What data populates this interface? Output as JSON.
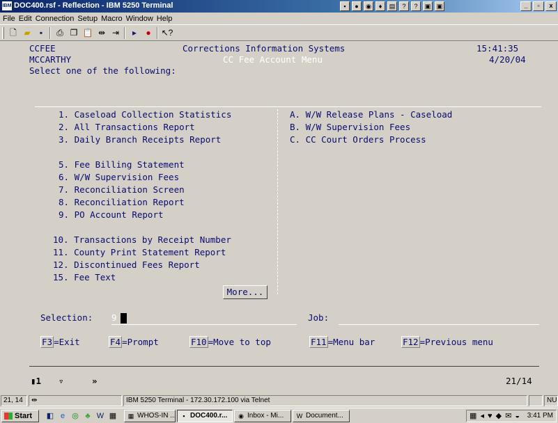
{
  "window": {
    "title": "DOC400.rsf - Reflection - IBM 5250 Terminal",
    "app_icon_text": "IBM",
    "caption_buttons": [
      "_",
      "▫",
      "x"
    ]
  },
  "menubar": [
    "File",
    "Edit",
    "Connection",
    "Setup",
    "Macro",
    "Window",
    "Help"
  ],
  "toolbar_icons": [
    "new-document-icon",
    "open-folder-icon",
    "save-icon",
    "print-icon",
    "copy-icon",
    "paste-icon",
    "connect-icon",
    "disconnect-icon",
    "play-macro-icon",
    "record-macro-icon",
    "context-help-icon"
  ],
  "terminal": {
    "header": {
      "library": "CCFEE",
      "system_name": "Corrections Information Systems",
      "time": "15:41:35",
      "user": "MCCARTHY",
      "menu_name": "CC Fee Account Menu",
      "date": "4/20/04",
      "instruction": "Select one of the following:"
    },
    "left_options": [
      "1. Caseload Collection Statistics",
      "2. All Transactions Report",
      "3. Daily Branch Receipts Report",
      "5. Fee Billing Statement",
      "6. W/W Supervision Fees",
      "7. Reconciliation Screen",
      "8. Reconciliation Report",
      "9. PO Account Report",
      "10. Transactions by Receipt Number",
      "11. County Print Statement Report",
      "12. Discontinued Fees Report",
      "15. Fee Text"
    ],
    "right_options": [
      "A. W/W Release Plans - Caseload",
      "B. W/W Supervision Fees",
      "C. CC Court Orders Process"
    ],
    "more_label": "More...",
    "selection_label": "Selection:",
    "selection_value": "9",
    "job_label": "Job:",
    "function_keys": [
      {
        "key": "F3",
        "label": "=Exit"
      },
      {
        "key": "F4",
        "label": "=Prompt"
      },
      {
        "key": "F10",
        "label": "=Move to top"
      },
      {
        "key": "F11",
        "label": "=Menu bar"
      },
      {
        "key": "F12",
        "label": "=Previous menu"
      }
    ],
    "oia": {
      "session_indicator": "1",
      "cursor_position": "21/14"
    }
  },
  "statusbar": {
    "cursor_position": "21, 14",
    "connection": "IBM 5250 Terminal - 172.30.172.100 via Telnet",
    "num_indicator": "NU"
  },
  "taskbar": {
    "start_label": "Start",
    "tasks": [
      "WHOS-IN ...",
      "DOC400.r...",
      "Inbox - Mi...",
      "Document..."
    ],
    "clock": "3:41 PM"
  }
}
